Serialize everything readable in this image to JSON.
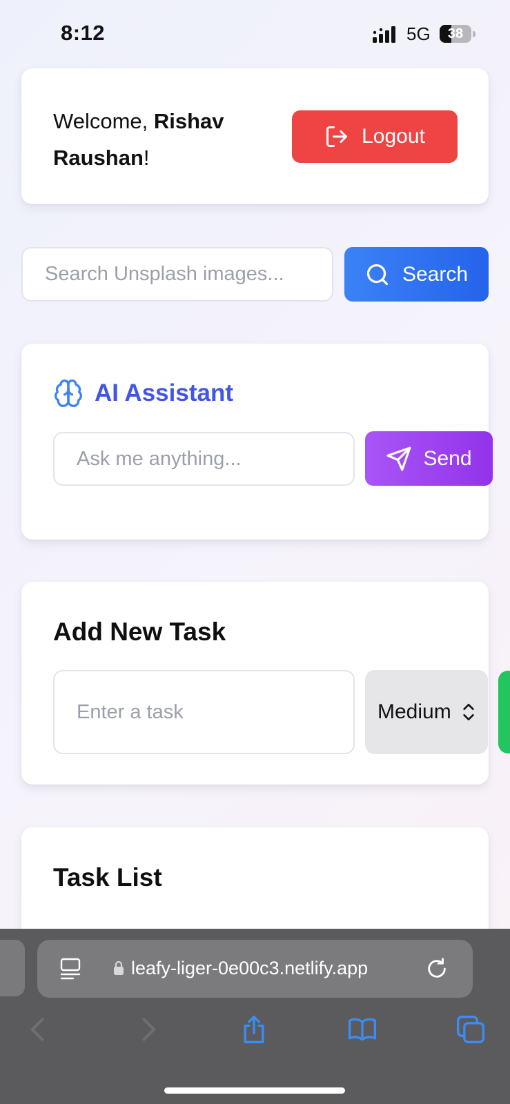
{
  "status_bar": {
    "time": "8:12",
    "network": "5G",
    "battery": "38",
    "battery_level": 0.38
  },
  "welcome": {
    "prefix": "Welcome, ",
    "name": "Rishav Raushan",
    "suffix": "!",
    "logout_label": "Logout"
  },
  "search": {
    "placeholder": "Search Unsplash images...",
    "button_label": "Search"
  },
  "ai_assistant": {
    "title": "AI Assistant",
    "placeholder": "Ask me anything...",
    "send_label": "Send"
  },
  "add_task": {
    "title": "Add New Task",
    "placeholder": "Enter a task",
    "priority": "Medium"
  },
  "task_list": {
    "title": "Task List"
  },
  "browser": {
    "url": "leafy-liger-0e00c3.netlify.app"
  },
  "colors": {
    "logout": "#ef4444",
    "search": "#2563eb",
    "send": "#9333ea",
    "ai_title": "#4355e6",
    "add_button": "#22c55e"
  }
}
